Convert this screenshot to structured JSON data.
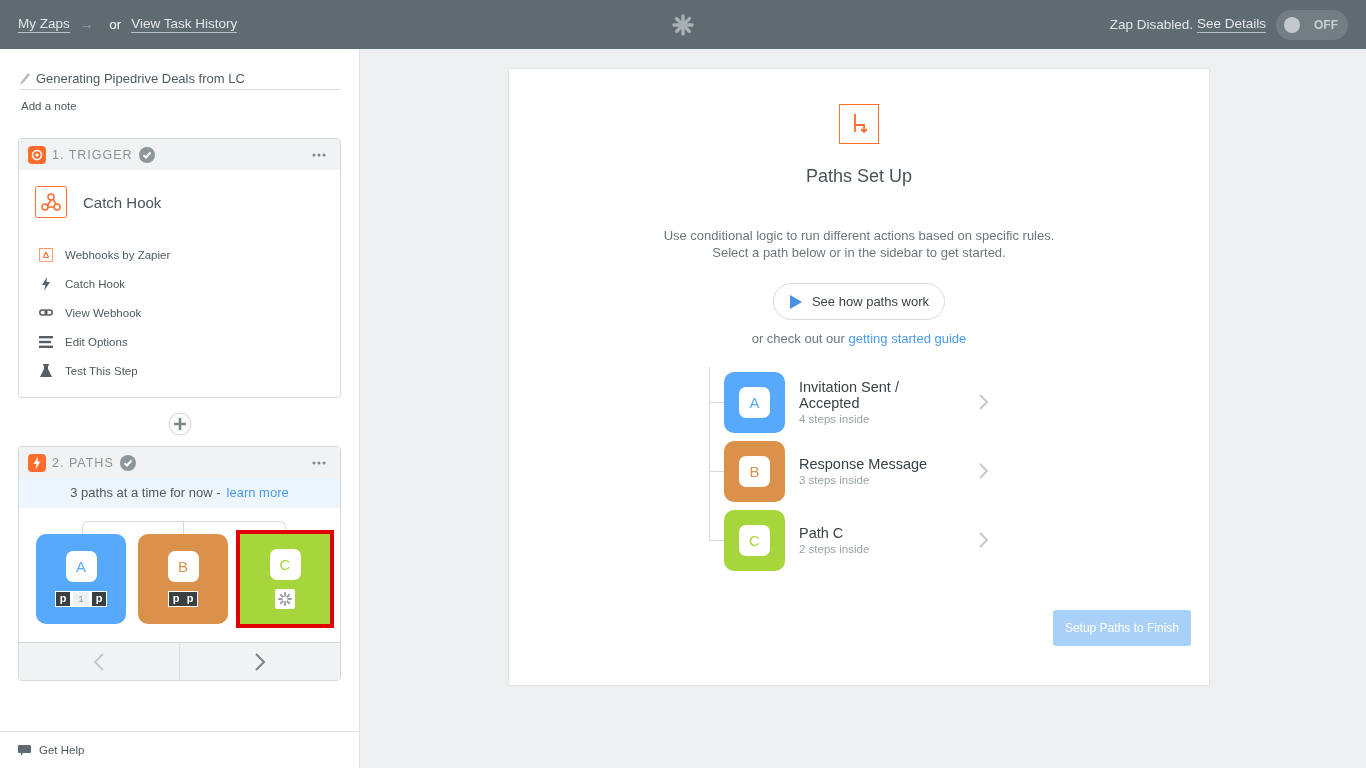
{
  "header": {
    "my_zaps": "My Zaps",
    "arrow": "→",
    "or": "or",
    "task_history": "View Task History",
    "status": "Zap Disabled.",
    "details": "See Details",
    "toggle": {
      "on": false,
      "label": "OFF"
    }
  },
  "sidebar": {
    "zap_name": "Generating Pipedrive Deals from LC",
    "note": "Add a note",
    "trigger": {
      "title": "1. TRIGGER",
      "done": true,
      "app_title": "Catch Hook",
      "items": [
        {
          "kind": "app",
          "label": "Webhooks by Zapier"
        },
        {
          "kind": "bolt",
          "label": "Catch Hook"
        },
        {
          "kind": "link",
          "label": "View Webhook"
        },
        {
          "kind": "list",
          "label": "Edit Options"
        },
        {
          "kind": "flask",
          "label": "Test This Step"
        }
      ]
    },
    "paths": {
      "title": "2. PATHS",
      "done": true,
      "notice": "3 paths at a time for now -",
      "link": "learn more",
      "paths": [
        {
          "letter": "A",
          "color": "#57a9fb",
          "selected": false,
          "badges": [
            {
              "kind": "app",
              "text": "p"
            },
            {
              "kind": "count",
              "text": "1"
            },
            {
              "kind": "app",
              "text": "p"
            }
          ]
        },
        {
          "letter": "B",
          "color": "#d9914b",
          "selected": false,
          "badges": [
            {
              "kind": "app",
              "text": "p"
            },
            {
              "kind": "app",
              "text": "p"
            }
          ]
        },
        {
          "letter": "C",
          "color": "#a6d63c",
          "selected": true,
          "badges": [
            {
              "kind": "gear"
            }
          ]
        }
      ],
      "prev_disabled": true,
      "next_disabled": false
    },
    "help": "Get Help"
  },
  "main": {
    "title": "Paths Set Up",
    "description": [
      "Use conditional logic to run different actions based on specific rules.",
      "Select a path below or in the sidebar to get started."
    ],
    "video_button": "See how paths work",
    "guide_prefix": "or check out our",
    "guide_link": "getting started guide",
    "paths": [
      {
        "letter": "A",
        "color": "#57a9fb",
        "name": "Invitation Sent / Accepted",
        "steps": "4 steps inside"
      },
      {
        "letter": "B",
        "color": "#d9914b",
        "name": "Response Message",
        "steps": "3 steps inside"
      },
      {
        "letter": "C",
        "color": "#a6d63c",
        "name": "Path C",
        "steps": "2 steps inside"
      }
    ],
    "finish_button": {
      "label": "Setup Paths to Finish",
      "disabled": true
    }
  }
}
